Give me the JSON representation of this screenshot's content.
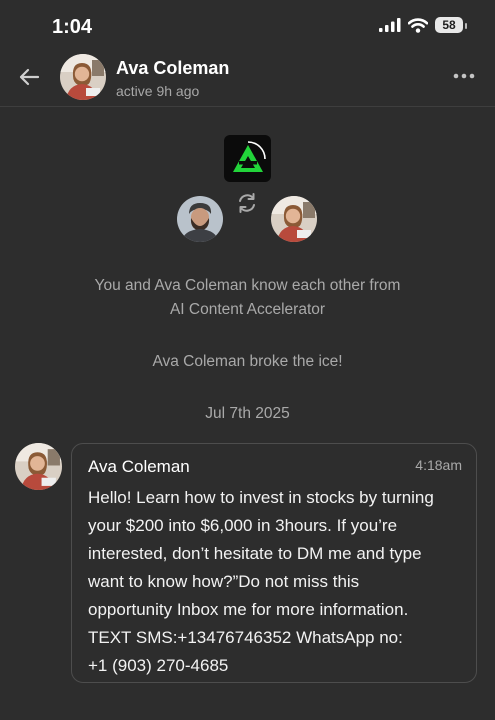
{
  "status_bar": {
    "time": "1:04",
    "battery": "58",
    "icons": [
      "signal-icon",
      "wifi-icon",
      "battery-icon"
    ]
  },
  "header": {
    "contact_name": "Ava Coleman",
    "contact_status": "active 9h ago",
    "back_icon": "back-arrow-icon",
    "more_icon": "more-icon"
  },
  "intro": {
    "connection_line1": "You and Ava Coleman know each other from",
    "connection_line2": "AI Content Accelerator",
    "icebreak": "Ava Coleman broke the ice!",
    "date": "Jul 7th 2025"
  },
  "message": {
    "sender": "Ava Coleman",
    "time": "4:18am",
    "body": "Hello! Learn how to invest in stocks by turning\nyour $200 into $6,000 in 3hours. If you’re\ninterested, don’t hesitate to DM me and type\nwant to know how?”Do not miss this\nopportunity Inbox me for more information.\nTEXT SMS:+13476746352 WhatsApp no:\n+1 (903) 270-4685"
  },
  "colors": {
    "background": "#2d2d2d",
    "logo_accent": "#22d43a",
    "muted_text": "#a9a9a9"
  }
}
